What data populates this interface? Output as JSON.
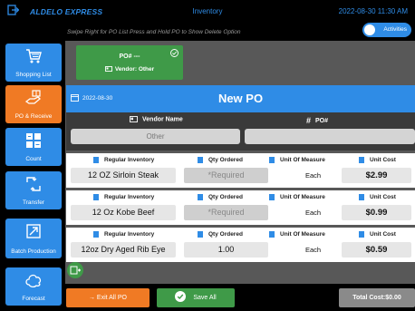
{
  "topbar": {
    "brand": "ALDELO EXPRESS",
    "title": "Inventory",
    "datetime": "2022-08-30 11:30 AM"
  },
  "hint": "Swipe Right for PO List    Press and Hold PO to Show Delete Option",
  "toggle": {
    "label": "Activities",
    "on": true
  },
  "sidebar": {
    "items": [
      {
        "label": "Shopping List",
        "icon": "cart-icon",
        "active": false
      },
      {
        "label": "PO & Receive",
        "icon": "hand-receive-icon",
        "active": true
      },
      {
        "label": "Count",
        "icon": "calculator-icon",
        "active": false
      },
      {
        "label": "Transfer",
        "icon": "transfer-icon",
        "active": false
      },
      {
        "label": "Batch Production",
        "icon": "batch-icon",
        "active": false
      },
      {
        "label": "Forecast",
        "icon": "cloud-icon",
        "active": false
      }
    ]
  },
  "po_card": {
    "po_number": "PO# ---",
    "vendor": "Vendor: Other"
  },
  "po_header": {
    "date": "2022-08-30",
    "title": "New PO"
  },
  "vendor_panel": {
    "vendor_name_label": "Vendor Name",
    "vendor_name_value": "Other",
    "po_label": "PO#",
    "po_value": ""
  },
  "column_labels": {
    "inventory": "Regular Inventory",
    "qty": "Qty Ordered",
    "uom": "Unit Of Measure",
    "cost": "Unit Cost"
  },
  "items": [
    {
      "name": "12 OZ Sirloin Steak",
      "qty": "",
      "qty_placeholder": "*Required",
      "uom": "Each",
      "cost": "$2.99"
    },
    {
      "name": "12 Oz Kobe Beef",
      "qty": "",
      "qty_placeholder": "*Required",
      "uom": "Each",
      "cost": "$0.99"
    },
    {
      "name": "12oz Dry Aged Rib Eye",
      "qty": "1.00",
      "qty_placeholder": "",
      "uom": "Each",
      "cost": "$0.59"
    }
  ],
  "footer": {
    "exit_label": "→ Exit All PO",
    "save_label": "Save All",
    "total_label": "Total Cost:$0.00"
  },
  "colors": {
    "blue": "#2f8ce6",
    "orange": "#f07a24",
    "green": "#3f9a48"
  }
}
